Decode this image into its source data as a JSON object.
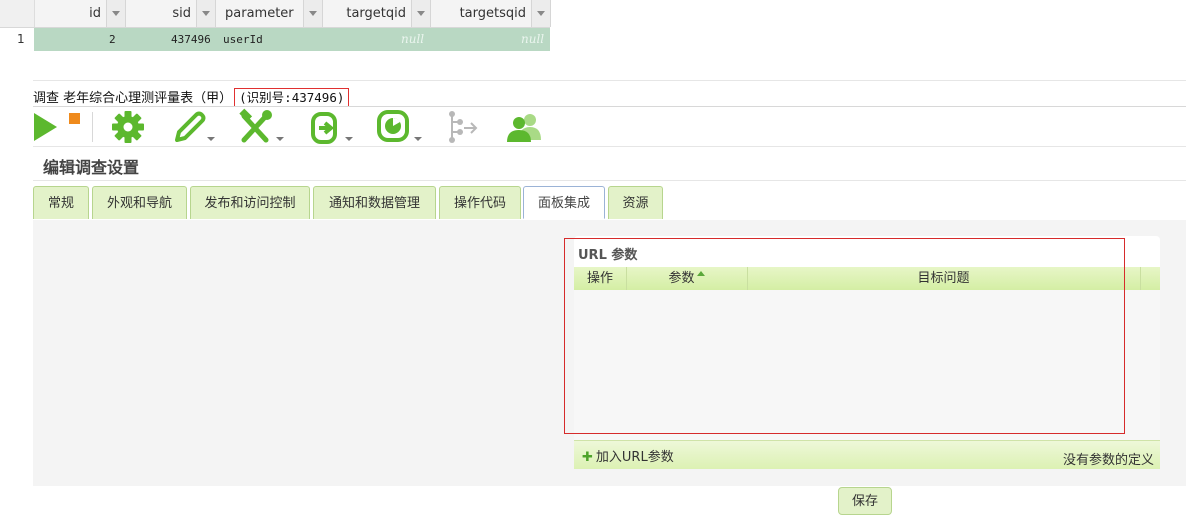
{
  "result_grid": {
    "row_number": "1",
    "columns": [
      "id",
      "sid",
      "parameter",
      "targetqid",
      "targetsqid"
    ],
    "rows": [
      {
        "id": "2",
        "sid": "437496",
        "parameter": "userId",
        "targetqid": "null",
        "targetsqid": "null"
      }
    ]
  },
  "survey": {
    "title_prefix": "调查 老年综合心理测评量表（甲）",
    "id_label": "(识别号:437496)"
  },
  "toolbar": {
    "icons": [
      "play-icon",
      "stop-icon",
      "gear-icon",
      "pencil-icon",
      "tools-icon",
      "export-icon",
      "chart-icon",
      "tree-icon",
      "users-icon"
    ],
    "colors": {
      "green": "#5cb82e",
      "orange": "#ef8a1c",
      "gray": "#b8b8b8"
    }
  },
  "page": {
    "heading": "编辑调查设置"
  },
  "tabs": [
    {
      "label": "常规"
    },
    {
      "label": "外观和导航"
    },
    {
      "label": "发布和访问控制"
    },
    {
      "label": "通知和数据管理"
    },
    {
      "label": "操作代码"
    },
    {
      "label": "面板集成",
      "active": true
    },
    {
      "label": "资源"
    }
  ],
  "url_params": {
    "title": "URL 参数",
    "columns": [
      "操作",
      "参数",
      "目标问题"
    ],
    "add_label": "加入URL参数",
    "empty_text": "没有参数的定义"
  },
  "save_label": "保存"
}
